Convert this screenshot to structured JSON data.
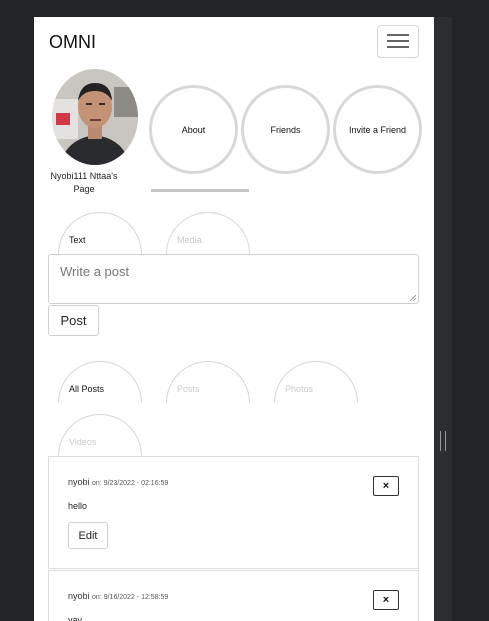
{
  "header": {
    "brand": "OMNI",
    "menu_icon": "hamburger-menu-icon"
  },
  "profile": {
    "name": "Nyobi111 Nttaa's",
    "page_label": "Page"
  },
  "profile_nav": {
    "items": [
      "About",
      "Friends",
      "Invite a Friend"
    ],
    "active": "About"
  },
  "composer": {
    "tabs": [
      {
        "label": "Text",
        "active": true
      },
      {
        "label": "Media",
        "active": false
      }
    ],
    "placeholder": "Write a post",
    "submit_label": "Post"
  },
  "feed_filter": {
    "tabs": [
      {
        "label": "All Posts",
        "active": true
      },
      {
        "label": "Posts",
        "active": false
      },
      {
        "label": "Photos",
        "active": false
      },
      {
        "label": "Videos",
        "active": false
      }
    ]
  },
  "posts": [
    {
      "author": "nyobi",
      "date": "on: 9/23/2022 - 02:16:59",
      "body": "hello",
      "edit_label": "Edit",
      "close_label": "×"
    },
    {
      "author": "nyobi",
      "date": "on: 9/16/2022 - 12:58:59",
      "body": "yay",
      "close_label": "×"
    }
  ],
  "colors": {
    "page_bg": "#ffffff",
    "outer_bg": "#222326",
    "tab_border": "#d6d6d6"
  }
}
